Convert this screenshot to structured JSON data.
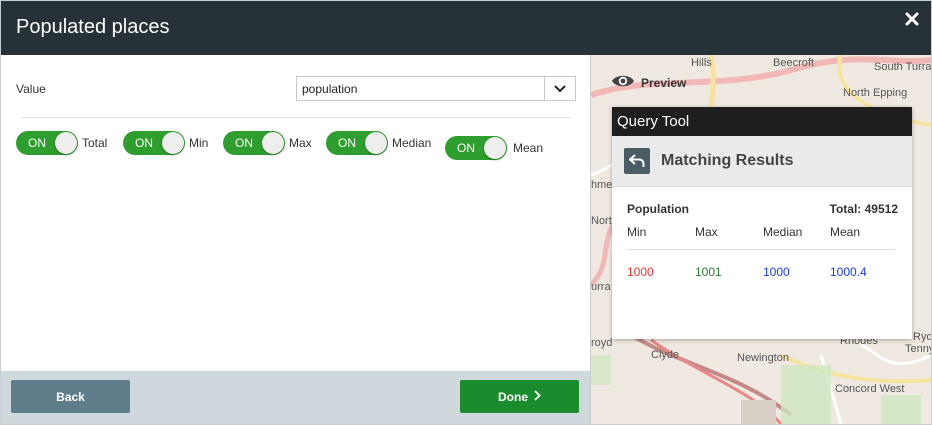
{
  "header": {
    "title": "Populated places",
    "close_icon": "close-icon"
  },
  "form": {
    "value_label": "Value",
    "select_value": "population"
  },
  "toggles": [
    {
      "state": "ON",
      "label": "Total"
    },
    {
      "state": "ON",
      "label": "Min"
    },
    {
      "state": "ON",
      "label": "Max"
    },
    {
      "state": "ON",
      "label": "Median"
    },
    {
      "state": "ON",
      "label": "Mean"
    }
  ],
  "footer": {
    "back_label": "Back",
    "done_label": "Done"
  },
  "map": {
    "labels": [
      "Hills",
      "Beecroft",
      "South Turra",
      "North Epping",
      "hme",
      "Nort",
      "urra",
      "royd",
      "Clyde",
      "Newington",
      "Rhodes",
      "Tenny",
      "Ryd",
      "Concord West"
    ]
  },
  "preview": {
    "label": "Preview"
  },
  "query_tool": {
    "title": "Query Tool",
    "subtitle": "Matching Results",
    "field": "Population",
    "total": "Total: 49512",
    "columns": [
      "Min",
      "Max",
      "Median",
      "Mean"
    ],
    "values": [
      "1000",
      "1001",
      "1000",
      "1000.4"
    ],
    "value_colors": [
      "#e53935",
      "#2e7d32",
      "#1e40e0",
      "#1e40e0"
    ]
  },
  "colors": {
    "header_bg": "#263238",
    "toggle_on": "#2e9e2e",
    "done_bg": "#1a8c2e",
    "back_bg": "#607d8b"
  }
}
